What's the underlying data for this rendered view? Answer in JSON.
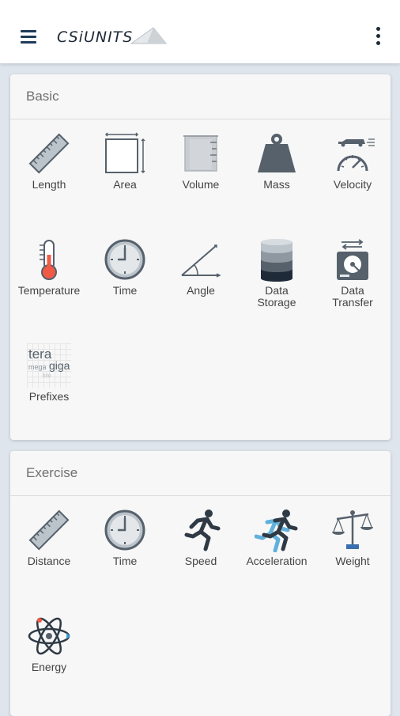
{
  "app": {
    "logo_text": "CSiUNITS"
  },
  "sections": [
    {
      "title": "Basic",
      "items": [
        {
          "label": "Length",
          "icon": "ruler-icon"
        },
        {
          "label": "Area",
          "icon": "area-icon"
        },
        {
          "label": "Volume",
          "icon": "beaker-icon"
        },
        {
          "label": "Mass",
          "icon": "weight-icon"
        },
        {
          "label": "Velocity",
          "icon": "speedometer-icon"
        },
        {
          "label": "Temperature",
          "icon": "thermometer-icon"
        },
        {
          "label": "Time",
          "icon": "clock-icon"
        },
        {
          "label": "Angle",
          "icon": "angle-icon"
        },
        {
          "label": "Data\nStorage",
          "icon": "database-icon"
        },
        {
          "label": "Data\nTransfer",
          "icon": "hard-drive-transfer-icon"
        },
        {
          "label": "Prefixes",
          "icon": "prefixes-icon"
        }
      ],
      "prefix_icon_words": [
        "tera",
        "mega",
        "giga",
        "kilo"
      ]
    },
    {
      "title": "Exercise",
      "items": [
        {
          "label": "Distance",
          "icon": "ruler-icon"
        },
        {
          "label": "Time",
          "icon": "clock-icon"
        },
        {
          "label": "Speed",
          "icon": "runner-icon"
        },
        {
          "label": "Acceleration",
          "icon": "runner-blur-icon"
        },
        {
          "label": "Weight",
          "icon": "scale-icon"
        },
        {
          "label": "Energy",
          "icon": "atom-icon"
        }
      ]
    }
  ],
  "colors": {
    "accent_red": "#f05a45",
    "icon_dark": "#56616c",
    "icon_light": "#bcc4cb",
    "blue": "#3a9fd3"
  }
}
